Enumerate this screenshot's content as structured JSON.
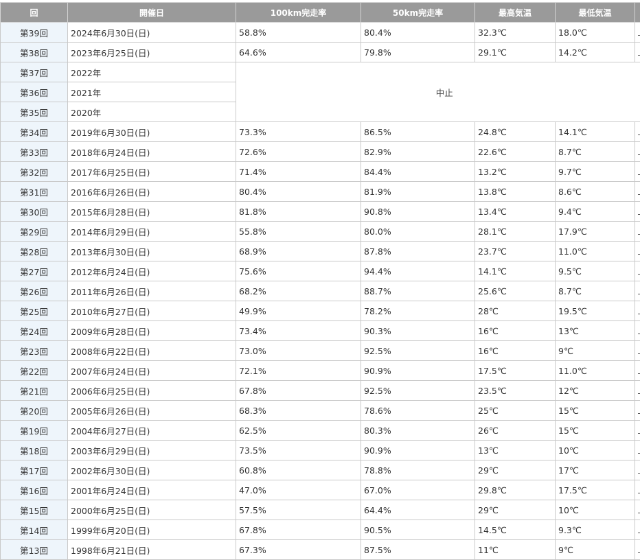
{
  "headers": [
    "回",
    "開催日",
    "100km完走率",
    "50km完走率",
    "最高気温",
    "最低気温"
  ],
  "cancel_text": "中止",
  "rows_top": [
    {
      "kai": "第39回",
      "date": "2024年6月30日(日)",
      "r100": "58.8%",
      "r50": "80.4%",
      "hi": "32.3℃",
      "lo": "18.0℃"
    },
    {
      "kai": "第38回",
      "date": "2023年6月25日(日)",
      "r100": "64.6%",
      "r50": "79.8%",
      "hi": "29.1℃",
      "lo": "14.2℃"
    }
  ],
  "rows_cancel": [
    {
      "kai": "第37回",
      "date": "2022年"
    },
    {
      "kai": "第36回",
      "date": "2021年"
    },
    {
      "kai": "第35回",
      "date": "2020年"
    }
  ],
  "rows_bottom": [
    {
      "kai": "第34回",
      "date": "2019年6月30日(日)",
      "r100": "73.3%",
      "r50": "86.5%",
      "hi": "24.8℃",
      "lo": "14.1℃"
    },
    {
      "kai": "第33回",
      "date": "2018年6月24日(日)",
      "r100": "72.6%",
      "r50": "82.9%",
      "hi": "22.6℃",
      "lo": "8.7℃"
    },
    {
      "kai": "第32回",
      "date": "2017年6月25日(日)",
      "r100": "71.4%",
      "r50": "84.4%",
      "hi": "13.2℃",
      "lo": "9.7℃"
    },
    {
      "kai": "第31回",
      "date": "2016年6月26日(日)",
      "r100": "80.4%",
      "r50": "81.9%",
      "hi": "13.8℃",
      "lo": "8.6℃"
    },
    {
      "kai": "第30回",
      "date": "2015年6月28日(日)",
      "r100": "81.8%",
      "r50": "90.8%",
      "hi": "13.4℃",
      "lo": "9.4℃"
    },
    {
      "kai": "第29回",
      "date": "2014年6月29日(日)",
      "r100": "55.8%",
      "r50": "80.0%",
      "hi": "28.1℃",
      "lo": "17.9℃"
    },
    {
      "kai": "第28回",
      "date": "2013年6月30日(日)",
      "r100": "68.9%",
      "r50": "87.8%",
      "hi": "23.7℃",
      "lo": "11.0℃"
    },
    {
      "kai": "第27回",
      "date": "2012年6月24日(日)",
      "r100": "75.6%",
      "r50": "94.4%",
      "hi": "14.1℃",
      "lo": "9.5℃"
    },
    {
      "kai": "第26回",
      "date": "2011年6月26日(日)",
      "r100": "68.2%",
      "r50": "88.7%",
      "hi": "25.6℃",
      "lo": "8.7℃"
    },
    {
      "kai": "第25回",
      "date": "2010年6月27日(日)",
      "r100": "49.9%",
      "r50": "78.2%",
      "hi": "28℃",
      "lo": "19.5℃"
    },
    {
      "kai": "第24回",
      "date": "2009年6月28日(日)",
      "r100": "73.4%",
      "r50": "90.3%",
      "hi": "16℃",
      "lo": "13℃"
    },
    {
      "kai": "第23回",
      "date": "2008年6月22日(日)",
      "r100": "73.0%",
      "r50": "92.5%",
      "hi": "16℃",
      "lo": "9℃"
    },
    {
      "kai": "第22回",
      "date": "2007年6月24日(日)",
      "r100": "72.1%",
      "r50": "90.9%",
      "hi": "17.5℃",
      "lo": "11.0℃"
    },
    {
      "kai": "第21回",
      "date": "2006年6月25日(日)",
      "r100": "67.8%",
      "r50": "92.5%",
      "hi": "23.5℃",
      "lo": "12℃"
    },
    {
      "kai": "第20回",
      "date": "2005年6月26日(日)",
      "r100": "68.3%",
      "r50": "78.6%",
      "hi": "25℃",
      "lo": "15℃"
    },
    {
      "kai": "第19回",
      "date": "2004年6月27日(日)",
      "r100": "62.5%",
      "r50": "80.3%",
      "hi": "26℃",
      "lo": "15℃"
    },
    {
      "kai": "第18回",
      "date": "2003年6月29日(日)",
      "r100": "73.5%",
      "r50": "90.9%",
      "hi": "13℃",
      "lo": "10℃"
    },
    {
      "kai": "第17回",
      "date": "2002年6月30日(日)",
      "r100": "60.8%",
      "r50": "78.8%",
      "hi": "29℃",
      "lo": "17℃"
    },
    {
      "kai": "第16回",
      "date": "2001年6月24日(日)",
      "r100": "47.0%",
      "r50": "67.0%",
      "hi": "29.8℃",
      "lo": "17.5℃"
    },
    {
      "kai": "第15回",
      "date": "2000年6月25日(日)",
      "r100": "57.5%",
      "r50": "64.4%",
      "hi": "29℃",
      "lo": "10℃"
    },
    {
      "kai": "第14回",
      "date": "1999年6月20日(日)",
      "r100": "67.8%",
      "r50": "90.5%",
      "hi": "14.5℃",
      "lo": "9.3℃"
    },
    {
      "kai": "第13回",
      "date": "1998年6月21日(日)",
      "r100": "67.3%",
      "r50": "87.5%",
      "hi": "11℃",
      "lo": "9℃"
    }
  ]
}
